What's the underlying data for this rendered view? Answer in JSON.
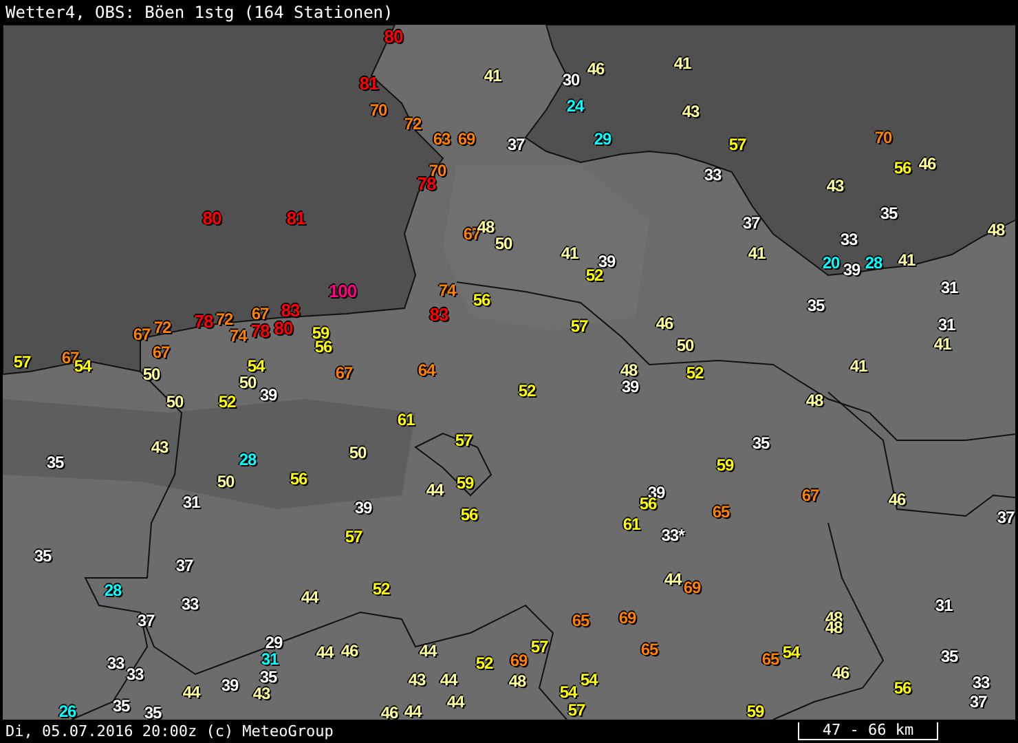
{
  "title": "Wetter4, OBS: Böen 1stg (164 Stationen)",
  "stations": [
    {
      "value": "80",
      "color": "#ff0000"
    },
    {
      "value": "81",
      "color": "#ff0000"
    },
    {
      "value": "70",
      "color": "#ff7f00"
    },
    {
      "value": "72",
      "color": "#ff7f00"
    },
    {
      "value": "63",
      "color": "#ff7f00"
    },
    {
      "value": "69",
      "color": "#ff7f00"
    },
    {
      "value": "37",
      "color": "#ffffff"
    },
    {
      "value": "70",
      "color": "#ff7f00"
    },
    {
      "value": "78",
      "color": "#ff0000"
    },
    {
      "value": "41",
      "color": "#ffff99"
    },
    {
      "value": "30",
      "color": "#ffffff"
    },
    {
      "value": "46",
      "color": "#ffff99"
    },
    {
      "value": "24",
      "color": "#00ffff"
    },
    {
      "value": "29",
      "color": "#00ffff"
    },
    {
      "value": "41",
      "color": "#ffff99"
    },
    {
      "value": "43",
      "color": "#ffff99"
    },
    {
      "value": "57",
      "color": "#ffff00"
    },
    {
      "value": "33",
      "color": "#ffffff"
    },
    {
      "value": "43",
      "color": "#ffff99"
    },
    {
      "value": "70",
      "color": "#ff7f00"
    },
    {
      "value": "56",
      "color": "#ffff00"
    },
    {
      "value": "46",
      "color": "#ffff99"
    },
    {
      "value": "37",
      "color": "#ffffff"
    },
    {
      "value": "35",
      "color": "#ffffff"
    },
    {
      "value": "33",
      "color": "#ffffff"
    },
    {
      "value": "48",
      "color": "#ffff99"
    },
    {
      "value": "41",
      "color": "#ffff99"
    },
    {
      "value": "20",
      "color": "#00ffff"
    },
    {
      "value": "39",
      "color": "#ffffff"
    },
    {
      "value": "28",
      "color": "#00ffff"
    },
    {
      "value": "41",
      "color": "#ffff99"
    },
    {
      "value": "31",
      "color": "#ffffff"
    },
    {
      "value": "35",
      "color": "#ffffff"
    },
    {
      "value": "31",
      "color": "#ffffff"
    },
    {
      "value": "41",
      "color": "#ffff99"
    },
    {
      "value": "41",
      "color": "#ffff99"
    },
    {
      "value": "80",
      "color": "#ff0000"
    },
    {
      "value": "81",
      "color": "#ff0000"
    },
    {
      "value": "100",
      "color": "#ff0080"
    },
    {
      "value": "67",
      "color": "#ff7f00"
    },
    {
      "value": "48",
      "color": "#ffff99"
    },
    {
      "value": "50",
      "color": "#ffff99"
    },
    {
      "value": "41",
      "color": "#ffff99"
    },
    {
      "value": "39",
      "color": "#ffffff"
    },
    {
      "value": "52",
      "color": "#ffff00"
    },
    {
      "value": "74",
      "color": "#ff7f00"
    },
    {
      "value": "56",
      "color": "#ffff00"
    },
    {
      "value": "83",
      "color": "#ff0000"
    },
    {
      "value": "57",
      "color": "#ffff00"
    },
    {
      "value": "46",
      "color": "#ffff99"
    },
    {
      "value": "50",
      "color": "#ffff99"
    },
    {
      "value": "48",
      "color": "#ffff99"
    },
    {
      "value": "52",
      "color": "#ffff00"
    },
    {
      "value": "39",
      "color": "#ffffff"
    },
    {
      "value": "67",
      "color": "#ff7f00"
    },
    {
      "value": "83",
      "color": "#ff0000"
    },
    {
      "value": "72",
      "color": "#ff7f00"
    },
    {
      "value": "78",
      "color": "#ff0000"
    },
    {
      "value": "72",
      "color": "#ff7f00"
    },
    {
      "value": "67",
      "color": "#ff7f00"
    },
    {
      "value": "74",
      "color": "#ff7f00"
    },
    {
      "value": "78",
      "color": "#ff0000"
    },
    {
      "value": "80",
      "color": "#ff0000"
    },
    {
      "value": "59",
      "color": "#ffff00"
    },
    {
      "value": "56",
      "color": "#ffff00"
    },
    {
      "value": "67",
      "color": "#ff7f00"
    },
    {
      "value": "57",
      "color": "#ffff00"
    },
    {
      "value": "67",
      "color": "#ff7f00"
    },
    {
      "value": "54",
      "color": "#ffff00"
    },
    {
      "value": "54",
      "color": "#ffff00"
    },
    {
      "value": "50",
      "color": "#ffff99"
    },
    {
      "value": "50",
      "color": "#ffff99"
    },
    {
      "value": "39",
      "color": "#ffffff"
    },
    {
      "value": "67",
      "color": "#ff7f00"
    },
    {
      "value": "64",
      "color": "#ff7f00"
    },
    {
      "value": "52",
      "color": "#ffff00"
    },
    {
      "value": "50",
      "color": "#ffff99"
    },
    {
      "value": "52",
      "color": "#ffff00"
    },
    {
      "value": "61",
      "color": "#ffff00"
    },
    {
      "value": "48",
      "color": "#ffff99"
    },
    {
      "value": "43",
      "color": "#ffff99"
    },
    {
      "value": "35",
      "color": "#ffffff"
    },
    {
      "value": "28",
      "color": "#00ffff"
    },
    {
      "value": "50",
      "color": "#ffff99"
    },
    {
      "value": "57",
      "color": "#ffff00"
    },
    {
      "value": "50",
      "color": "#ffff99"
    },
    {
      "value": "56",
      "color": "#ffff00"
    },
    {
      "value": "59",
      "color": "#ffff00"
    },
    {
      "value": "35",
      "color": "#ffffff"
    },
    {
      "value": "44",
      "color": "#ffff99"
    },
    {
      "value": "59",
      "color": "#ffff00"
    },
    {
      "value": "31",
      "color": "#ffffff"
    },
    {
      "value": "39",
      "color": "#ffffff"
    },
    {
      "value": "56",
      "color": "#ffff00"
    },
    {
      "value": "39",
      "color": "#ffffff"
    },
    {
      "value": "56",
      "color": "#ffff00"
    },
    {
      "value": "65",
      "color": "#ff7f00"
    },
    {
      "value": "67",
      "color": "#ff7f00"
    },
    {
      "value": "46",
      "color": "#ffff99"
    },
    {
      "value": "37",
      "color": "#ffffff"
    },
    {
      "value": "61",
      "color": "#ffff00"
    },
    {
      "value": "33*",
      "color": "#ffffff"
    },
    {
      "value": "57",
      "color": "#ffff00"
    },
    {
      "value": "35",
      "color": "#ffffff"
    },
    {
      "value": "37",
      "color": "#ffffff"
    },
    {
      "value": "28",
      "color": "#00ffff"
    },
    {
      "value": "44",
      "color": "#ffff99"
    },
    {
      "value": "69",
      "color": "#ff7f00"
    },
    {
      "value": "33",
      "color": "#ffffff"
    },
    {
      "value": "44",
      "color": "#ffff99"
    },
    {
      "value": "52",
      "color": "#ffff00"
    },
    {
      "value": "31",
      "color": "#ffffff"
    },
    {
      "value": "37",
      "color": "#ffffff"
    },
    {
      "value": "65",
      "color": "#ff7f00"
    },
    {
      "value": "69",
      "color": "#ff7f00"
    },
    {
      "value": "48",
      "color": "#ffff99"
    },
    {
      "value": "48",
      "color": "#ffff99"
    },
    {
      "value": "29",
      "color": "#ffffff"
    },
    {
      "value": "31",
      "color": "#00ffff"
    },
    {
      "value": "44",
      "color": "#ffff99"
    },
    {
      "value": "46",
      "color": "#ffff99"
    },
    {
      "value": "44",
      "color": "#ffff99"
    },
    {
      "value": "57",
      "color": "#ffff00"
    },
    {
      "value": "65",
      "color": "#ff7f00"
    },
    {
      "value": "54",
      "color": "#ffff00"
    },
    {
      "value": "65",
      "color": "#ff7f00"
    },
    {
      "value": "35",
      "color": "#ffffff"
    },
    {
      "value": "33",
      "color": "#ffffff"
    },
    {
      "value": "35",
      "color": "#ffffff"
    },
    {
      "value": "52",
      "color": "#ffff00"
    },
    {
      "value": "69",
      "color": "#ff7f00"
    },
    {
      "value": "33",
      "color": "#ffffff"
    },
    {
      "value": "46",
      "color": "#ffff99"
    },
    {
      "value": "39",
      "color": "#ffffff"
    },
    {
      "value": "43",
      "color": "#ffff99"
    },
    {
      "value": "44",
      "color": "#ffff99"
    },
    {
      "value": "48",
      "color": "#ffff99"
    },
    {
      "value": "54",
      "color": "#ffff00"
    },
    {
      "value": "44",
      "color": "#ffff99"
    },
    {
      "value": "43",
      "color": "#ffff99"
    },
    {
      "value": "56",
      "color": "#ffff00"
    },
    {
      "value": "33",
      "color": "#ffffff"
    },
    {
      "value": "54",
      "color": "#ffff00"
    },
    {
      "value": "26",
      "color": "#00ffff"
    },
    {
      "value": "35",
      "color": "#ffffff"
    },
    {
      "value": "35",
      "color": "#ffffff"
    },
    {
      "value": "46",
      "color": "#ffff99"
    },
    {
      "value": "44",
      "color": "#ffff99"
    },
    {
      "value": "44",
      "color": "#ffff99"
    },
    {
      "value": "57",
      "color": "#ffff00"
    },
    {
      "value": "59",
      "color": "#ffff00"
    },
    {
      "value": "37",
      "color": "#ffffff"
    }
  ],
  "footer": {
    "timestamp": "Di, 05.07.2016 20:00z (c) MeteoGroup",
    "scale": "47 - 66 km"
  }
}
